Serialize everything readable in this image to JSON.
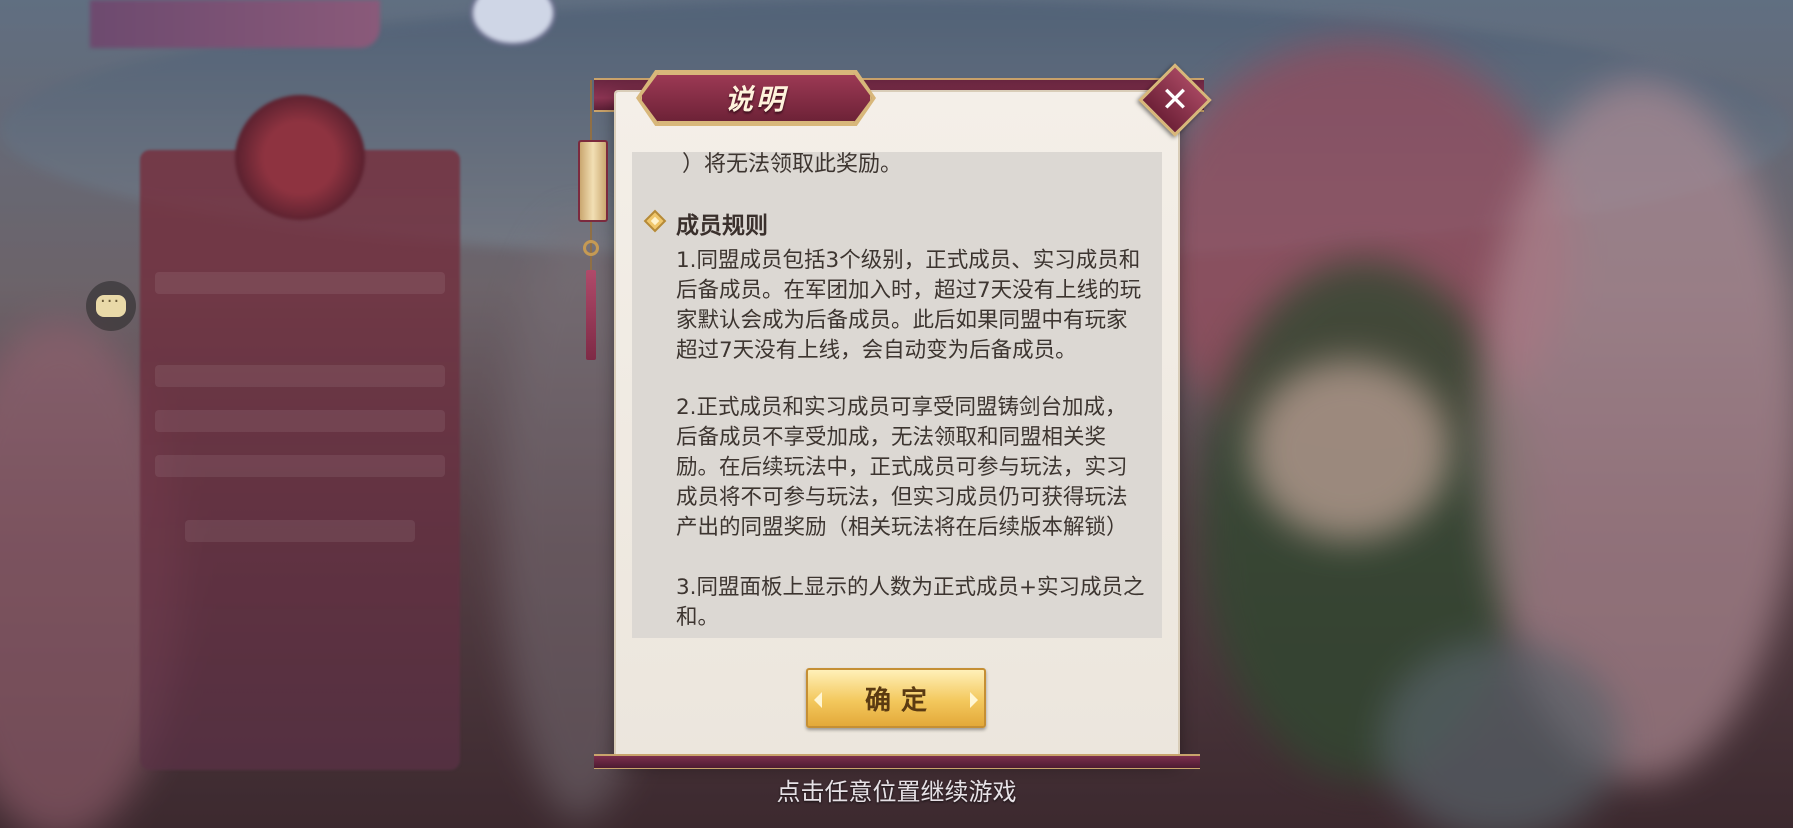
{
  "dialog": {
    "title": "说明",
    "clipped_line": "）将无法领取此奖励。",
    "section_title": "成员规则",
    "rules": [
      "1.同盟成员包括3个级别，正式成员、实习成员和后备成员。在军团加入时，超过7天没有上线的玩家默认会成为后备成员。此后如果同盟中有玩家超过7天没有上线，会自动变为后备成员。",
      "2.正式成员和实习成员可享受同盟铸剑台加成，后备成员不享受加成，无法领取和同盟相关奖励。在后续玩法中，正式成员可参与玩法，实习成员将不可参与玩法，但实习成员仍可获得玩法产出的同盟奖励（相关玩法将在后续版本解锁）",
      "3.同盟面板上显示的人数为正式成员+实习成员之和。"
    ],
    "confirm_label": "确定",
    "close_symbol": "✕"
  },
  "hint": "点击任意位置继续游戏",
  "colors": {
    "frame": "#8c3452",
    "gold": "#d8b77a",
    "button": "#f3c85d",
    "panel_bg": "#dcd8d3"
  },
  "icons": [
    "chat-icon",
    "close-icon",
    "diamond-bullet-icon",
    "lantern-ornament"
  ]
}
